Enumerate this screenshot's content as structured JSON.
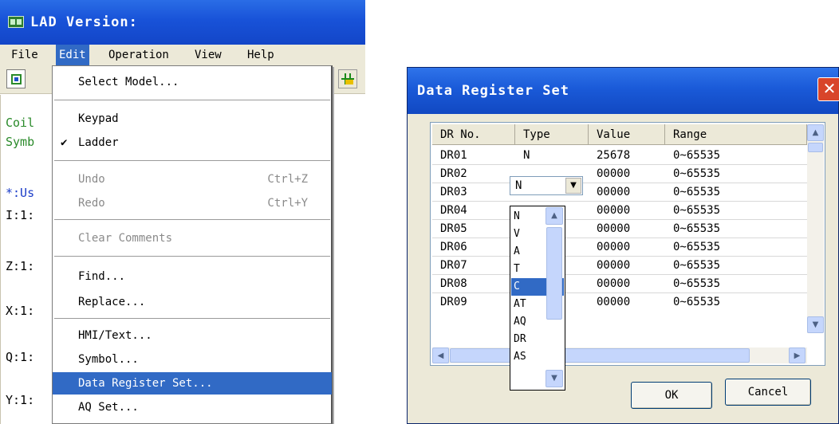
{
  "main_window": {
    "title": "LAD Version:",
    "menu": [
      "File",
      "Edit",
      "Operation",
      "View",
      "Help"
    ],
    "active_menu": "Edit",
    "editor_lines": [
      "Coil",
      "Symb",
      "*:Us",
      "I:1:",
      "Z:1:",
      "X:1:",
      "Q:1:",
      "Y:1:"
    ]
  },
  "edit_menu": {
    "items": [
      {
        "label": "Select Model...",
        "shortcut": "",
        "disabled": false,
        "checked": false,
        "selected": false
      },
      {
        "label": "Keypad",
        "shortcut": "",
        "disabled": false,
        "checked": false,
        "selected": false
      },
      {
        "label": "Ladder",
        "shortcut": "",
        "disabled": false,
        "checked": true,
        "selected": false
      },
      {
        "label": "Undo",
        "shortcut": "Ctrl+Z",
        "disabled": true,
        "checked": false,
        "selected": false
      },
      {
        "label": "Redo",
        "shortcut": "Ctrl+Y",
        "disabled": true,
        "checked": false,
        "selected": false
      },
      {
        "label": "Clear Comments",
        "shortcut": "",
        "disabled": true,
        "checked": false,
        "selected": false
      },
      {
        "label": "Find...",
        "shortcut": "",
        "disabled": false,
        "checked": false,
        "selected": false
      },
      {
        "label": "Replace...",
        "shortcut": "",
        "disabled": false,
        "checked": false,
        "selected": false
      },
      {
        "label": "HMI/Text...",
        "shortcut": "",
        "disabled": false,
        "checked": false,
        "selected": false
      },
      {
        "label": "Symbol...",
        "shortcut": "",
        "disabled": false,
        "checked": false,
        "selected": false
      },
      {
        "label": "Data Register Set...",
        "shortcut": "",
        "disabled": false,
        "checked": false,
        "selected": true
      },
      {
        "label": "AQ Set...",
        "shortcut": "",
        "disabled": false,
        "checked": false,
        "selected": false
      }
    ],
    "check_mark": "✔"
  },
  "dialog": {
    "title": "Data Register Set",
    "close_glyph": "✕",
    "columns": [
      "DR No.",
      "Type",
      "Value",
      "Range"
    ],
    "rows": [
      {
        "dr": "DR01",
        "type": "N",
        "value": "25678",
        "range": "0~65535"
      },
      {
        "dr": "DR02",
        "type": "N",
        "value": "00000",
        "range": "0~65535"
      },
      {
        "dr": "DR03",
        "type": "",
        "value": "00000",
        "range": "0~65535"
      },
      {
        "dr": "DR04",
        "type": "",
        "value": "00000",
        "range": "0~65535"
      },
      {
        "dr": "DR05",
        "type": "",
        "value": "00000",
        "range": "0~65535"
      },
      {
        "dr": "DR06",
        "type": "",
        "value": "00000",
        "range": "0~65535"
      },
      {
        "dr": "DR07",
        "type": "",
        "value": "00000",
        "range": "0~65535"
      },
      {
        "dr": "DR08",
        "type": "",
        "value": "00000",
        "range": "0~65535"
      },
      {
        "dr": "DR09",
        "type": "",
        "value": "00000",
        "range": "0~65535"
      }
    ],
    "type_combo_value": "N",
    "type_options": [
      "N",
      "V",
      "A",
      "T",
      "C",
      "AT",
      "AQ",
      "DR",
      "AS"
    ],
    "type_selected": "C",
    "ok_label": "OK",
    "cancel_label": "Cancel"
  },
  "colors": {
    "title_blue": "#1852d8",
    "menu_highlight": "#316ac5",
    "close_red": "#d8452a",
    "editor_green": "#2a8a2a",
    "editor_blue": "#1a3cc8"
  }
}
